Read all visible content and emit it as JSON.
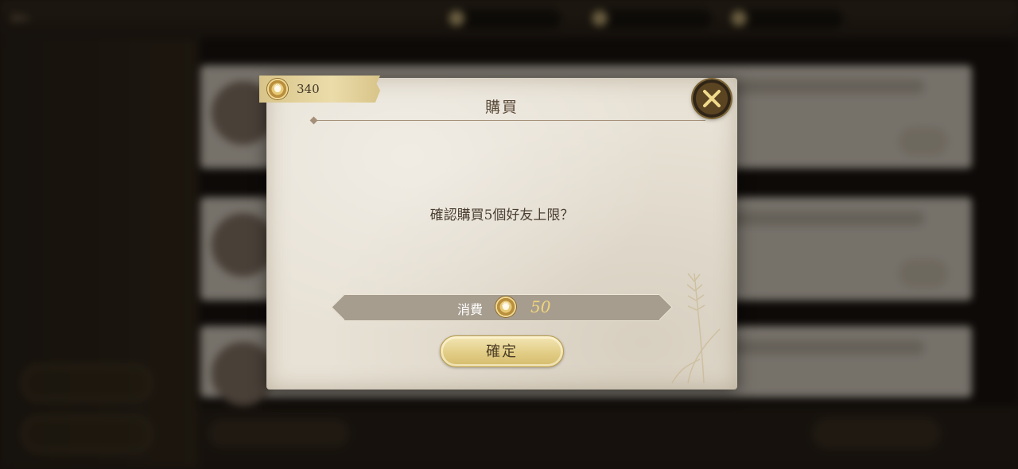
{
  "dialog": {
    "title": "購買",
    "message": "確認購買5個好友上限？",
    "cost_label": "消費",
    "cost_value": "50",
    "confirm_label": "確定",
    "currency_amount": "340",
    "close_icon": "close-icon",
    "coin_icon": "gold-coin-icon"
  },
  "colors": {
    "paper": "#e8e2d6",
    "accent_gold": "#e2cd86",
    "cost_value": "#f2d47a",
    "title_text": "#5a4a38"
  }
}
